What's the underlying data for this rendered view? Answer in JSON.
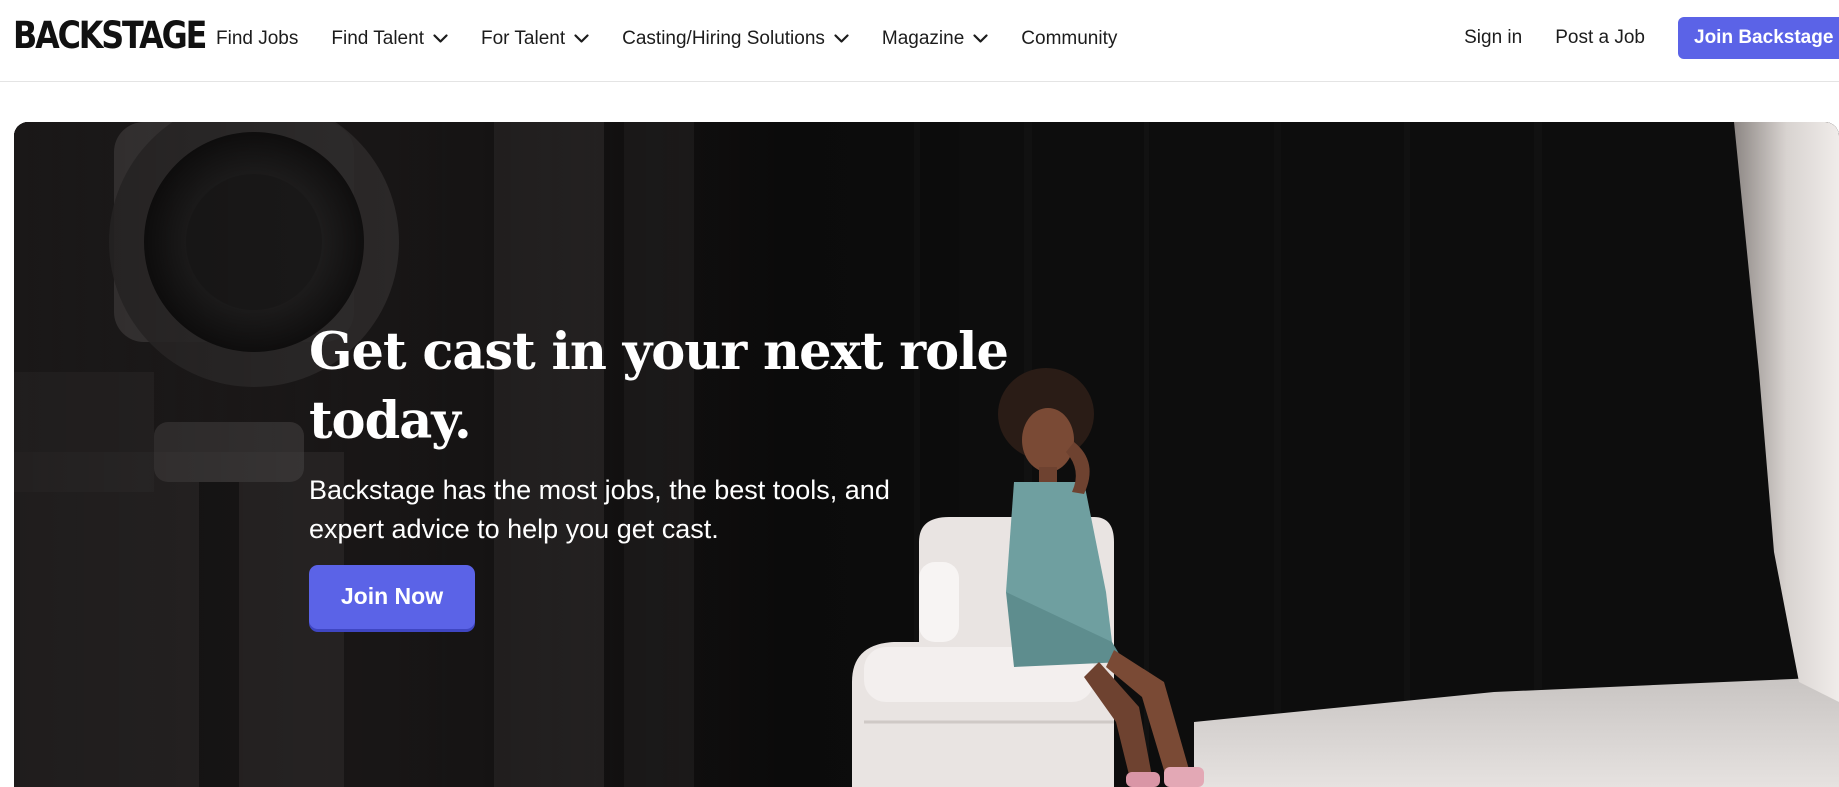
{
  "brand": {
    "logo_text": "BACKSTAGE"
  },
  "nav": {
    "items": [
      {
        "label": "Find Jobs",
        "has_dropdown": false
      },
      {
        "label": "Find Talent",
        "has_dropdown": true
      },
      {
        "label": "For Talent",
        "has_dropdown": true
      },
      {
        "label": "Casting/Hiring Solutions",
        "has_dropdown": true
      },
      {
        "label": "Magazine",
        "has_dropdown": true
      },
      {
        "label": "Community",
        "has_dropdown": false
      }
    ],
    "sign_in": "Sign in",
    "post_job": "Post a Job",
    "join_button": "Join Backstage"
  },
  "hero": {
    "title": "Get cast in your next role today.",
    "subtitle": "Backstage has the most jobs, the best tools, and expert advice to help you get cast.",
    "cta_label": "Join Now"
  },
  "colors": {
    "accent": "#5b63e7",
    "hero_background": "#0c0c0c",
    "text_dark": "#1c1c1c"
  }
}
